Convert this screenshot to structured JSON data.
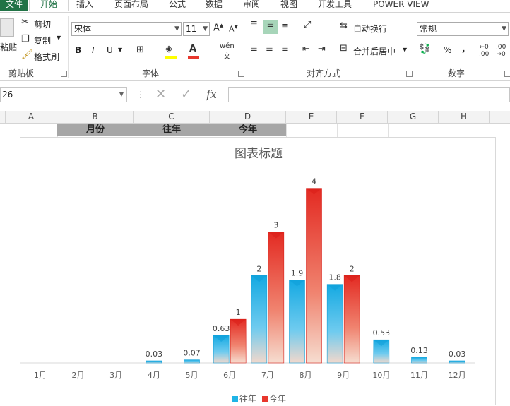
{
  "ribbon_tabs": [
    "文件",
    "开始",
    "插入",
    "页面布局",
    "公式",
    "数据",
    "审阅",
    "视图",
    "开发工具",
    "POWER VIEW"
  ],
  "clipboard": {
    "paste": "粘贴",
    "cut": "剪切",
    "copy": "复制",
    "format_painter": "格式刷",
    "label": "剪贴板"
  },
  "font": {
    "name": "宋体",
    "size": "11",
    "bold": "B",
    "italic": "I",
    "underline": "U",
    "label": "字体"
  },
  "alignment": {
    "wrap_text": "自动换行",
    "merge_center": "合并后居中",
    "label": "对齐方式"
  },
  "number": {
    "format": "常规",
    "percent": "%",
    "comma": ",",
    "label": "数字"
  },
  "formula_bar": {
    "name_box": "26",
    "fx": "fx",
    "value": ""
  },
  "columns": [
    "A",
    "B",
    "C",
    "D",
    "E",
    "F",
    "G",
    "H"
  ],
  "header_cells": {
    "b": "月份",
    "c": "往年",
    "d": "今年"
  },
  "colors": {
    "excel_green": "#217346",
    "series1": "#1fb4e6",
    "series2": "#e8372d"
  },
  "chart_data": {
    "type": "bar",
    "title": "图表标题",
    "categories": [
      "1月",
      "2月",
      "3月",
      "4月",
      "5月",
      "6月",
      "7月",
      "8月",
      "9月",
      "10月",
      "11月",
      "12月"
    ],
    "series": [
      {
        "name": "往年",
        "values": [
          null,
          null,
          null,
          0.03,
          0.07,
          0.63,
          2,
          1.9,
          1.8,
          0.53,
          0.13,
          0.03
        ]
      },
      {
        "name": "今年",
        "values": [
          null,
          null,
          null,
          null,
          null,
          1,
          3,
          4,
          2,
          null,
          null,
          null
        ]
      }
    ],
    "ylim": [
      0,
      4.5
    ],
    "legend": "bottom",
    "grid": false
  }
}
